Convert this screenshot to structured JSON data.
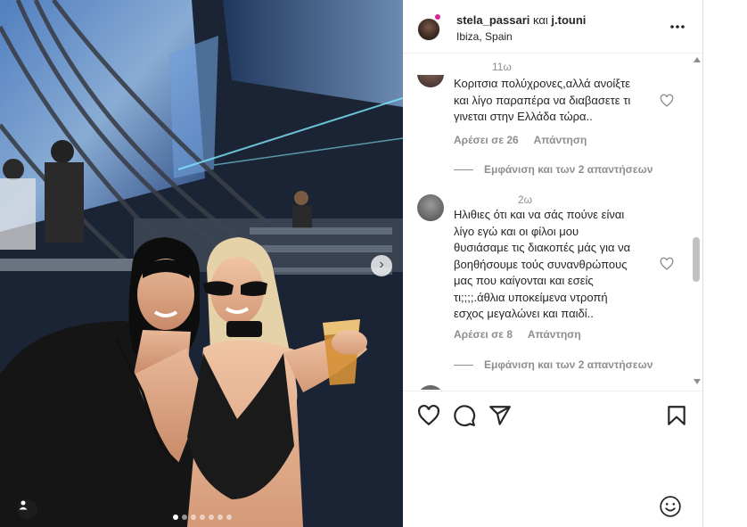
{
  "post": {
    "photo": {
      "carousel_total": 7,
      "carousel_active": 0,
      "next_icon": "chevron-right-icon",
      "tag_icon": "user-tag-icon"
    },
    "header": {
      "username": "stela_passari",
      "connector": "και",
      "collaborator": "j.touni",
      "location": "Ibiza, Spain",
      "more_icon": "more-horizontal-icon"
    },
    "comments": [
      {
        "time": "11ω",
        "lines": [
          "Κοριτσια πολύχρονες,αλλά ανοίξτε",
          "και λίγο παραπέρα να διαβασετε τι",
          "γινεται στην Ελλάδα τώρα.."
        ],
        "likes": "Αρέσει σε 26",
        "reply": "Απάντηση",
        "view_replies": "Εμφάνιση και των 2 απαντήσεων"
      },
      {
        "time": "2ω",
        "lines": [
          "Ηλιθιες ότι και να σάς πούνε είναι",
          "λίγο εγώ και οι φίλοι μου",
          "θυσιάσαμε τις διακοπές μάς για να",
          "βοηθήσουμε τούς συνανθρώπους",
          "μας που καίγονται και εσείς",
          "τι;;;;.άθλια υποκείμενα ντροπή",
          "εσχος μεγαλώνει και παιδί.."
        ],
        "likes": "Αρέσει σε 8",
        "reply": "Απάντηση",
        "view_replies": "Εμφάνιση και των 2 απαντήσεων"
      }
    ],
    "actions": {
      "like_icon": "heart-icon",
      "comment_icon": "comment-icon",
      "share_icon": "share-icon",
      "save_icon": "bookmark-icon",
      "emoji_icon": "emoji-icon"
    }
  },
  "colors": {
    "text": "#262626",
    "secondary": "#8e8e8e",
    "border": "#dbdbdb",
    "story_ring": "#d6249f"
  }
}
